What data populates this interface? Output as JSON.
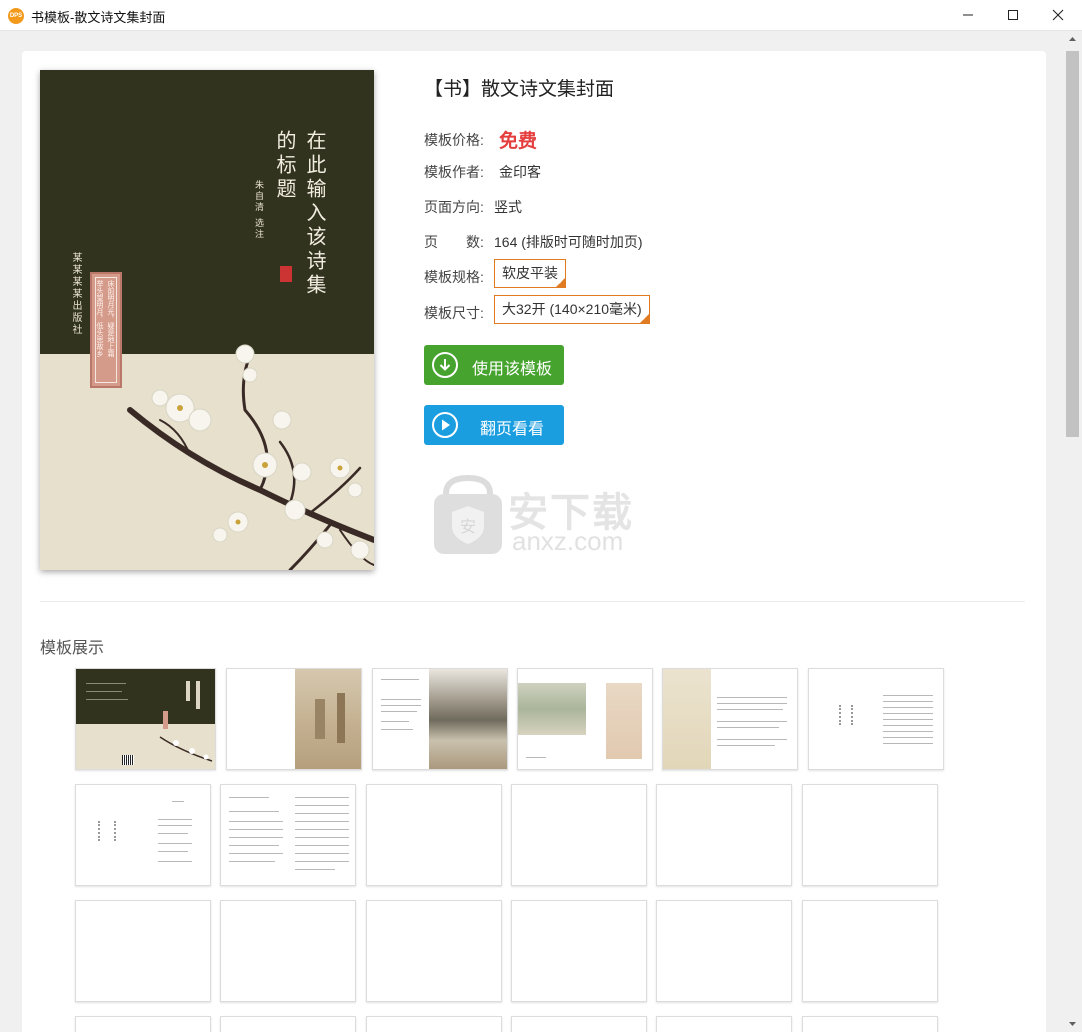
{
  "window": {
    "title": "书模板-散文诗文集封面",
    "app_icon_text": "DPS"
  },
  "cover": {
    "title": "在此输入该诗集的标题",
    "title_col1": "在此输入该诗集",
    "title_col2": "的标题",
    "author": "朱自清 选注",
    "publisher": "某某某某出版社",
    "band_text_1": "床前明月光，疑是地上霜",
    "band_text_2": "举头望明月，低头思故乡"
  },
  "info": {
    "title": "【书】散文诗文集封面",
    "price_label": "模板价格:",
    "price_value": "免费",
    "author_label": "模板作者:",
    "author_value": "金印客",
    "orientation_label": "页面方向:",
    "orientation_value": "竖式",
    "pages_label": "页　　数:",
    "pages_value": "164 (排版时可随时加页)",
    "spec_label": "模板规格:",
    "spec_value": "软皮平装",
    "size_label": "模板尺寸:",
    "size_value": "大32开 (140×210毫米)"
  },
  "buttons": {
    "use_template": "使用该模板",
    "flip_preview": "翻页看看"
  },
  "watermark": {
    "cn": "安下载",
    "en": "anxz.com"
  },
  "showcase": {
    "title": "模板展示"
  },
  "colors": {
    "price_red": "#e53e3e",
    "button_green": "#45a32e",
    "button_blue": "#1b9ee0",
    "tag_orange": "#e07b22",
    "cover_dark": "#32331f",
    "cover_light": "#e6e0cc"
  }
}
